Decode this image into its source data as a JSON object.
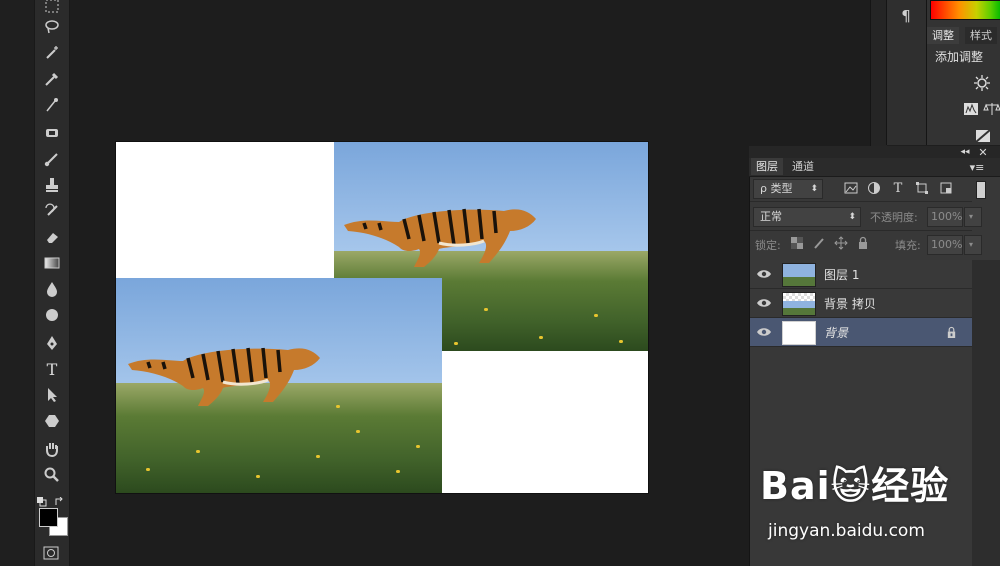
{
  "toolbar": {
    "tools": [
      "marquee-tool",
      "lasso-tool",
      "magic-wand-tool",
      "eyedropper-tool",
      "color-sampler-tool",
      "spot-healing-tool",
      "brush-tool",
      "clone-stamp-tool",
      "history-brush-tool",
      "eraser-tool",
      "gradient-tool",
      "blur-tool",
      "dodge-tool",
      "pen-tool",
      "type-tool",
      "path-select-tool",
      "shape-tool",
      "hand-tool",
      "zoom-tool"
    ],
    "type_glyph": "T"
  },
  "mini_panel": {
    "paragraph_glyph": "¶"
  },
  "adjust_panel": {
    "tabs": [
      "调整",
      "样式"
    ],
    "heading": "添加调整"
  },
  "layers_panel": {
    "tabs": [
      "图层",
      "通道"
    ],
    "filter_label": "ρ 类型",
    "blend_mode": "正常",
    "opacity_label": "不透明度:",
    "opacity_value": "100%",
    "lock_label": "锁定:",
    "fill_label": "填充:",
    "fill_value": "100%",
    "layers": [
      {
        "name": "图层 1",
        "visible": true,
        "selected": false,
        "locked": false
      },
      {
        "name": "背景 拷贝",
        "visible": true,
        "selected": false,
        "locked": false
      },
      {
        "name": "背景",
        "visible": true,
        "selected": true,
        "locked": true
      }
    ]
  },
  "watermark": {
    "logo_text": "Bai😺经验",
    "url": "jingyan.baidu.com"
  },
  "colors": {
    "panel_bg": "#383838",
    "selected_layer": "#4a5772",
    "workspace_bg": "#1d1d1d"
  }
}
